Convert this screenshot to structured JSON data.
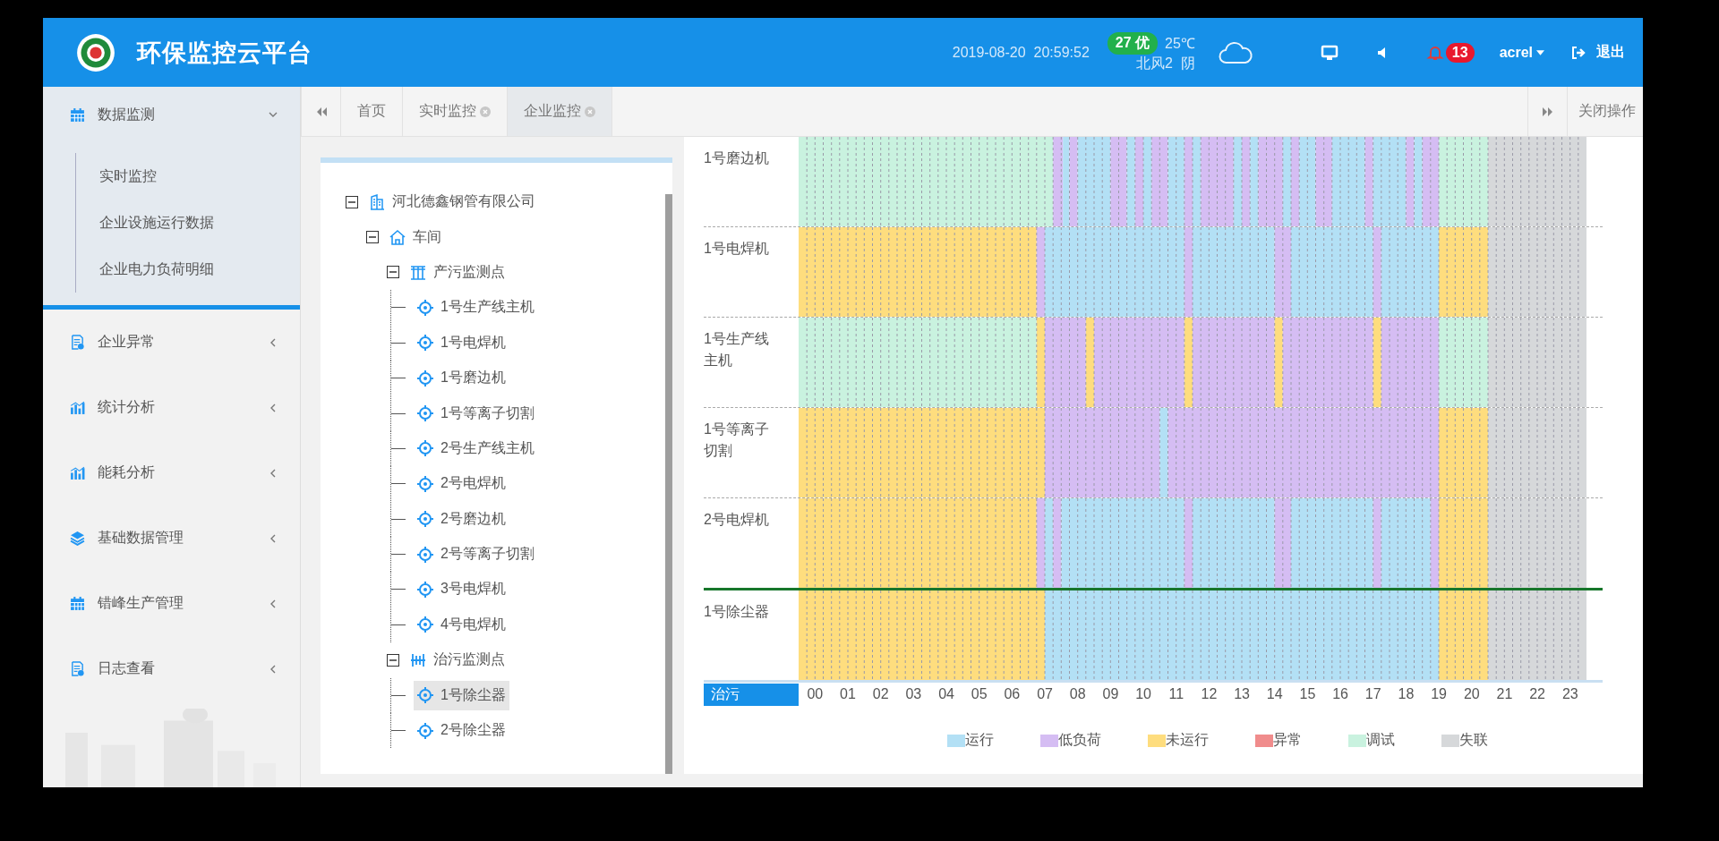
{
  "header": {
    "title": "环保监控云平台",
    "datetime": "2019-08-20  20:59:52",
    "aqi_value": "27",
    "aqi_grade": "优",
    "temperature": "25℃",
    "weather": "北风2  阴",
    "alerts": "13",
    "user": "acrel",
    "logout": "退出"
  },
  "sidebar": {
    "items": [
      {
        "label": "数据监测",
        "kind": "calendar",
        "expanded": true,
        "children": [
          {
            "label": "实时监控",
            "selected": false
          },
          {
            "label": "企业设施运行数据",
            "selected": false
          },
          {
            "label": "企业电力负荷明细",
            "selected": false
          }
        ]
      },
      {
        "label": "企业异常",
        "kind": "doc",
        "expanded": false
      },
      {
        "label": "统计分析",
        "kind": "bars",
        "expanded": false
      },
      {
        "label": "能耗分析",
        "kind": "bars",
        "expanded": false
      },
      {
        "label": "基础数据管理",
        "kind": "layers",
        "expanded": false
      },
      {
        "label": "错峰生产管理",
        "kind": "calendar",
        "expanded": false
      },
      {
        "label": "日志查看",
        "kind": "doc",
        "expanded": false
      }
    ]
  },
  "tabs": [
    {
      "label": "首页",
      "closable": false,
      "selected": false
    },
    {
      "label": "实时监控",
      "closable": true,
      "selected": false
    },
    {
      "label": "企业监控",
      "closable": true,
      "selected": true
    }
  ],
  "close_operations": "关闭操作",
  "tree": {
    "nodes": [
      {
        "label": "河北德鑫钢管有限公司",
        "kind": "company",
        "expanded": true,
        "selected": false,
        "children": [
          {
            "label": "车间",
            "kind": "workshop",
            "expanded": true,
            "selected": false,
            "children": [
              {
                "label": "产污监测点",
                "kind": "source",
                "expanded": true,
                "selected": false,
                "children": [
                  {
                    "label": "1号生产线主机",
                    "kind": "device",
                    "selected": false
                  },
                  {
                    "label": "1号电焊机",
                    "kind": "device",
                    "selected": false
                  },
                  {
                    "label": "1号磨边机",
                    "kind": "device",
                    "selected": false
                  },
                  {
                    "label": "1号等离子切割",
                    "kind": "device",
                    "selected": false
                  },
                  {
                    "label": "2号生产线主机",
                    "kind": "device",
                    "selected": false
                  },
                  {
                    "label": "2号电焊机",
                    "kind": "device",
                    "selected": false
                  },
                  {
                    "label": "2号磨边机",
                    "kind": "device",
                    "selected": false
                  },
                  {
                    "label": "2号等离子切割",
                    "kind": "device",
                    "selected": false
                  },
                  {
                    "label": "3号电焊机",
                    "kind": "device",
                    "selected": false
                  },
                  {
                    "label": "4号电焊机",
                    "kind": "device",
                    "selected": false
                  }
                ]
              },
              {
                "label": "治污监测点",
                "kind": "treatment",
                "expanded": true,
                "selected": false,
                "children": [
                  {
                    "label": "1号除尘器",
                    "kind": "device",
                    "selected": true
                  },
                  {
                    "label": "2号除尘器",
                    "kind": "device",
                    "selected": false
                  }
                ]
              }
            ]
          }
        ]
      }
    ]
  },
  "timeline": {
    "rows": [
      {
        "label": "1号磨边机",
        "divider_above": false
      },
      {
        "label": "1号电焊机",
        "divider_above": false
      },
      {
        "label": "1号生产线主机",
        "divider_above": false
      },
      {
        "label": "1号等离子切割",
        "divider_above": false
      },
      {
        "label": "2号电焊机",
        "divider_above": false
      },
      {
        "label": "1号除尘器",
        "divider_above": true
      }
    ],
    "group_label": "治污",
    "hours": [
      "00",
      "01",
      "02",
      "03",
      "04",
      "05",
      "06",
      "07",
      "08",
      "09",
      "10",
      "11",
      "12",
      "13",
      "14",
      "15",
      "16",
      "17",
      "18",
      "19",
      "20",
      "21",
      "22",
      "23"
    ],
    "legend": [
      {
        "kind": "run",
        "label": "运行",
        "color": "#b3e0f5"
      },
      {
        "kind": "low",
        "label": "低负荷",
        "color": "#d5bdf3"
      },
      {
        "kind": "idle",
        "label": "未运行",
        "color": "#fedd7e"
      },
      {
        "kind": "fault",
        "label": "异常",
        "color": "#f08c8c"
      },
      {
        "kind": "test",
        "label": "调试",
        "color": "#c9f2df"
      },
      {
        "kind": "lost",
        "label": "失联",
        "color": "#d6d8da"
      }
    ]
  }
}
